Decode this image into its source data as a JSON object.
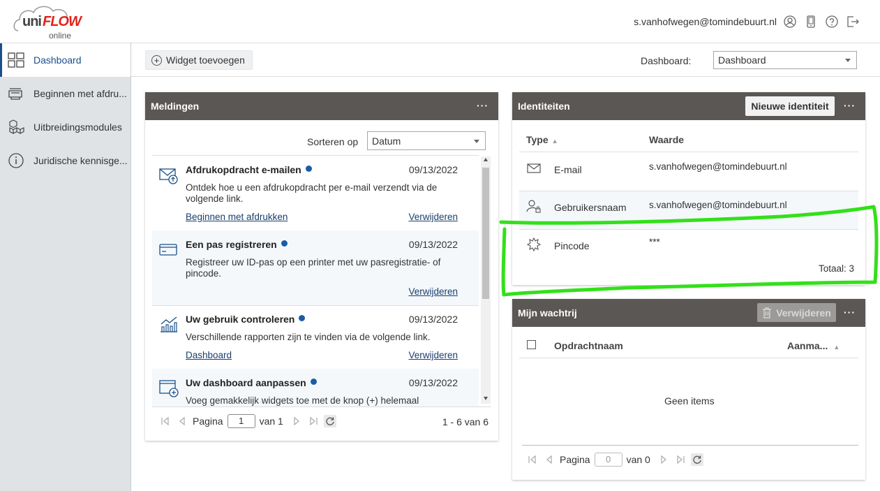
{
  "app": {
    "logo_uni": "uni",
    "logo_flow": "FLOW",
    "logo_online": "online"
  },
  "header": {
    "user_email": "s.vanhofwegen@tomindebuurt.nl"
  },
  "sidebar": {
    "items": [
      {
        "label": "Dashboard",
        "icon": "dashboard-icon",
        "active": true
      },
      {
        "label": "Beginnen met afdru...",
        "icon": "printer-tray-icon"
      },
      {
        "label": "Uitbreidingsmodules",
        "icon": "cubes-icon"
      },
      {
        "label": "Juridische kennisge...",
        "icon": "info-icon"
      }
    ]
  },
  "toolbar": {
    "add_widget_label": "Widget toevoegen",
    "dashboard_label": "Dashboard:",
    "dashboard_value": "Dashboard"
  },
  "meldingen": {
    "title": "Meldingen",
    "sort_label": "Sorteren op",
    "sort_value": "Datum",
    "items": [
      {
        "title": "Afdrukopdracht e-mailen",
        "date": "09/13/2022",
        "desc": "Ontdek hoe u een afdrukopdracht per e-mail verzendt via de volgende link.",
        "link": "Beginnen met afdrukken",
        "delete": "Verwijderen",
        "icon": "mail-upload-icon"
      },
      {
        "title": "Een pas registreren",
        "date": "09/13/2022",
        "desc": "Registreer uw ID-pas op een printer met uw pasregistratie- of pincode.",
        "link": "",
        "delete": "Verwijderen",
        "icon": "card-icon"
      },
      {
        "title": "Uw gebruik controleren",
        "date": "09/13/2022",
        "desc": "Verschillende rapporten zijn te vinden via de volgende link.",
        "link": "Dashboard",
        "delete": "Verwijderen",
        "icon": "chart-icon"
      },
      {
        "title": "Uw dashboard aanpassen",
        "date": "09/13/2022",
        "desc": "Voeg gemakkelijk widgets toe met de knop (+) helemaal",
        "link": "",
        "delete": "",
        "icon": "window-add-icon"
      }
    ],
    "pager": {
      "page_label": "Pagina",
      "page_value": "1",
      "of_label": "van 1",
      "range": "1 - 6 van 6"
    }
  },
  "identiteiten": {
    "title": "Identiteiten",
    "new_button": "Nieuwe identiteit",
    "col_type": "Type",
    "col_value": "Waarde",
    "rows": [
      {
        "type": "E-mail",
        "value": "s.vanhofwegen@tomindebuurt.nl",
        "icon": "envelope-icon"
      },
      {
        "type": "Gebruikersnaam",
        "value": "s.vanhofwegen@tomindebuurt.nl",
        "icon": "user-lock-icon"
      },
      {
        "type": "Pincode",
        "value": "***",
        "icon": "keypad-icon"
      }
    ],
    "total": "Totaal: 3"
  },
  "wachtrij": {
    "title": "Mijn wachtrij",
    "delete_button": "Verwijderen",
    "col_name": "Opdrachtnaam",
    "col_created": "Aanma...",
    "empty": "Geen items",
    "pager": {
      "page_label": "Pagina",
      "page_value": "0",
      "of_label": "van 0"
    }
  },
  "annotation": {
    "color": "#33e01a"
  }
}
